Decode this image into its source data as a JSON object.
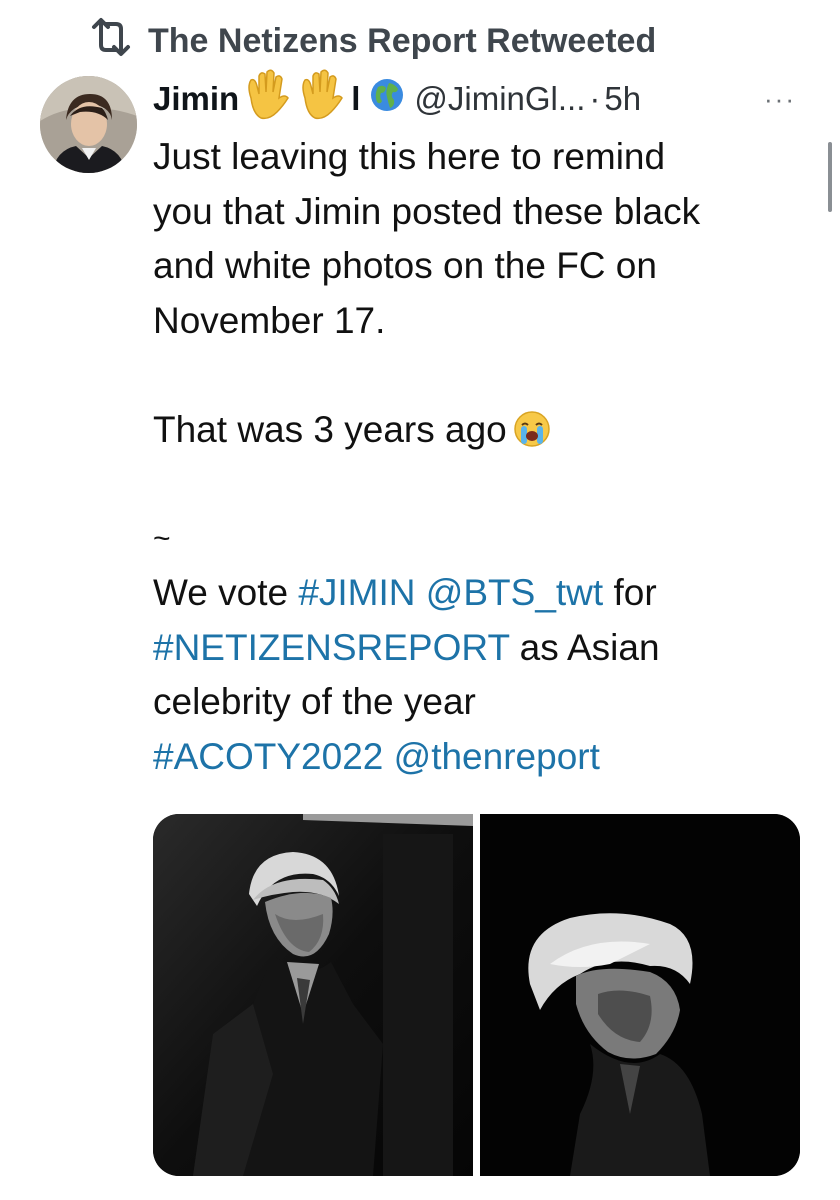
{
  "retweet_banner": {
    "icon": "retweet-icon",
    "text": "The Netizens Report Retweeted"
  },
  "tweet": {
    "author": {
      "display_name_start": "Jimin",
      "display_name_end": "l",
      "name_emojis": [
        "raised-hand-emoji",
        "raised-hand-emoji"
      ],
      "badge_icon": "globe-icon",
      "handle": "@JiminGl...",
      "separator": "·",
      "time": "5h"
    },
    "more_label": "···",
    "text_lines": {
      "l1": "Just leaving this here to remind",
      "l2": "you that Jimin posted these black",
      "l3": "and white photos on the FC on",
      "l4": "November 17.",
      "l5": "That was 3 years ago",
      "l6": "~",
      "l7_a": "We vote ",
      "l7_tag": "#JIMIN",
      "l7_b": " ",
      "l7_mention": "@BTS_twt",
      "l7_c": " for",
      "l8_tag": "#NETIZENSREPORT",
      "l8_b": " as Asian",
      "l9": "celebrity of the year",
      "l10_tag": "#ACOTY2022",
      "l10_b": " ",
      "l10_mention": "@thenreport"
    },
    "crying_emoji": "loudly-crying-face-emoji",
    "photos": [
      "black-and-white-photo-1",
      "black-and-white-photo-2"
    ],
    "colors": {
      "link": "#1d73a8",
      "text": "#0f1419",
      "secondary": "#2f3439"
    }
  }
}
